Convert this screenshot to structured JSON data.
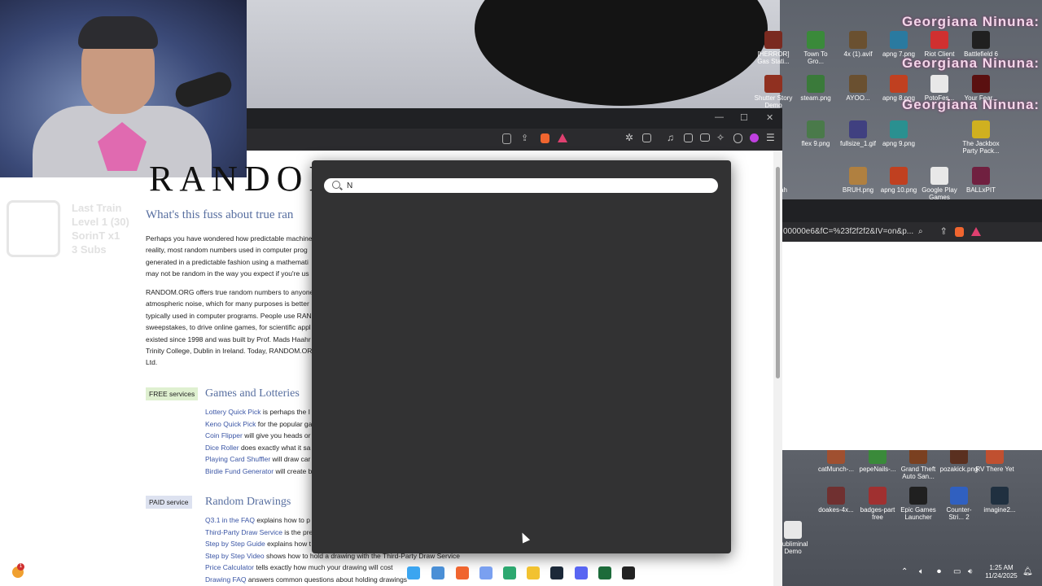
{
  "desktop": {
    "name_banner": "Georgiana Ninuna:",
    "icons": [
      {
        "label": "[HERROR] Gas Stati...",
        "color": "#7a2a20"
      },
      {
        "label": "Town To Gro...",
        "color": "#3a8a3a"
      },
      {
        "label": "4x (1).avif",
        "color": "#6a5030"
      },
      {
        "label": "apng 7.png",
        "color": "#2a7aa0"
      },
      {
        "label": "Riot Client",
        "color": "#d03030"
      },
      {
        "label": "Battlefield 6",
        "color": "#202020"
      },
      {
        "label": "Shutter Story Demo",
        "color": "#903020"
      },
      {
        "label": "steam.png",
        "color": "#3a7a3a"
      },
      {
        "label": "AYOO...",
        "color": "#6a5030"
      },
      {
        "label": "apng 8.png",
        "color": "#c04020"
      },
      {
        "label": "PotoFes...",
        "color": "#e8e8e8"
      },
      {
        "label": "Your Fear...",
        "color": "#5a1010"
      },
      {
        "label": "flex 9.png",
        "color": "#4a7a4a"
      },
      {
        "label": "fullsize_1.gif",
        "color": "#404080"
      },
      {
        "label": "apng 9.png",
        "color": "#2a9090"
      },
      {
        "label": "The Jackbox Party Pack...",
        "color": "#d0b020"
      },
      {
        "label": "Hell Yeah Hero",
        "color": "#203020"
      },
      {
        "label": "BRUH.png",
        "color": "#b08040"
      },
      {
        "label": "apng 10.png",
        "color": "#c04020"
      },
      {
        "label": "Google Play Games",
        "color": "#e8e8e8"
      },
      {
        "label": "BALLxPIT",
        "color": "#702040"
      }
    ],
    "lower_icons": [
      {
        "label": "catMunch-...",
        "color": "#a05030"
      },
      {
        "label": "pepeNails-...",
        "color": "#3a8a3a"
      },
      {
        "label": "Grand Theft Auto San...",
        "color": "#7a4020"
      },
      {
        "label": "pozakick.png",
        "color": "#5a3020"
      },
      {
        "label": "RV There Yet",
        "color": "#c05030"
      },
      {
        "label": "doakes-4x...",
        "color": "#703030"
      },
      {
        "label": "badges-part free",
        "color": "#a03030"
      },
      {
        "label": "Epic Games Launcher",
        "color": "#202020"
      },
      {
        "label": "Counter-Stri... 2",
        "color": "#3060c0"
      },
      {
        "label": "imagine2...",
        "color": "#203040"
      },
      {
        "label": "Subliminal Demo",
        "color": "#e8e8e8"
      }
    ]
  },
  "stream_overlay": {
    "last_train_label": "Last Train",
    "level_label": "Level 1 (30)",
    "user_label": "SorinT x1",
    "subs_label": "3 Subs"
  },
  "right_window": {
    "url_fragment": "00000e6&fC=%23f2f2f2&IV=on&p..."
  },
  "page": {
    "title_partial": "RANDOM.",
    "heading_partial": "What's this fuss about true ran",
    "para1": [
      "Perhaps you have wondered how predictable machine",
      "reality, most random numbers used in computer prog",
      "generated in a predictable fashion using a mathemati",
      "may not be random in the way you expect if you're us"
    ],
    "para2": [
      "RANDOM.ORG offers true random numbers to anyone",
      "atmospheric noise, which for many purposes is better",
      "typically used in computer programs. People use RAN",
      "sweepstakes, to drive online games, for scientific appl",
      "existed since 1998 and was built by Prof. Mads Haahr",
      "Trinity College, Dublin in Ireland. Today, RANDOM.ORG",
      "Ltd."
    ],
    "free_badge": "FREE services",
    "games_heading": "Games and Lotteries",
    "games_items": [
      {
        "link": "Lottery Quick Pick",
        "rest": " is perhaps the I"
      },
      {
        "link": "Keno Quick Pick",
        "rest": " for the popular ga"
      },
      {
        "link": "Coin Flipper",
        "rest": " will give you heads or"
      },
      {
        "link": "Dice Roller",
        "rest": " does exactly what it sa"
      },
      {
        "link": "Playing Card Shuffler",
        "rest": " will draw car"
      },
      {
        "link": "Birdie Fund Generator",
        "rest": " will create b"
      }
    ],
    "paid_badge": "PAID service",
    "drawings_heading": "Random Drawings",
    "drawings_items": [
      {
        "link": "Q3.1 in the FAQ",
        "rest": " explains how to p"
      },
      {
        "link": "Third-Party Draw Service",
        "rest": " is the pre"
      },
      {
        "link": "Step by Step Guide",
        "rest": " explains how t"
      },
      {
        "link": "Step by Step Video",
        "rest": " shows how to hold a drawing with the Third-Party Draw Service"
      },
      {
        "link": "Price Calculator",
        "rest": " tells exactly how much your drawing will cost"
      },
      {
        "link": "Drawing FAQ",
        "rest": " answers common questions about holding drawings"
      }
    ],
    "partial_header_text": "RANDOM.ORG"
  },
  "search": {
    "value": "N",
    "placeholder": ""
  },
  "taskbar": {
    "time": "1:25 AM",
    "date": "11/24/2025",
    "notification_count": "1",
    "apps": [
      {
        "name": "windows-start",
        "color": "#3ba5f0"
      },
      {
        "name": "file-window",
        "color": "#4a8fd6"
      },
      {
        "name": "brave-browser",
        "color": "#f0652f"
      },
      {
        "name": "copilot",
        "color": "#7aa0f0"
      },
      {
        "name": "app-green",
        "color": "#2da870"
      },
      {
        "name": "file-explorer",
        "color": "#f2c230"
      },
      {
        "name": "steam",
        "color": "#1b2838"
      },
      {
        "name": "discord",
        "color": "#5865f2"
      },
      {
        "name": "excel-like",
        "color": "#1d6b3a"
      },
      {
        "name": "epic-games",
        "color": "#222222"
      }
    ]
  }
}
